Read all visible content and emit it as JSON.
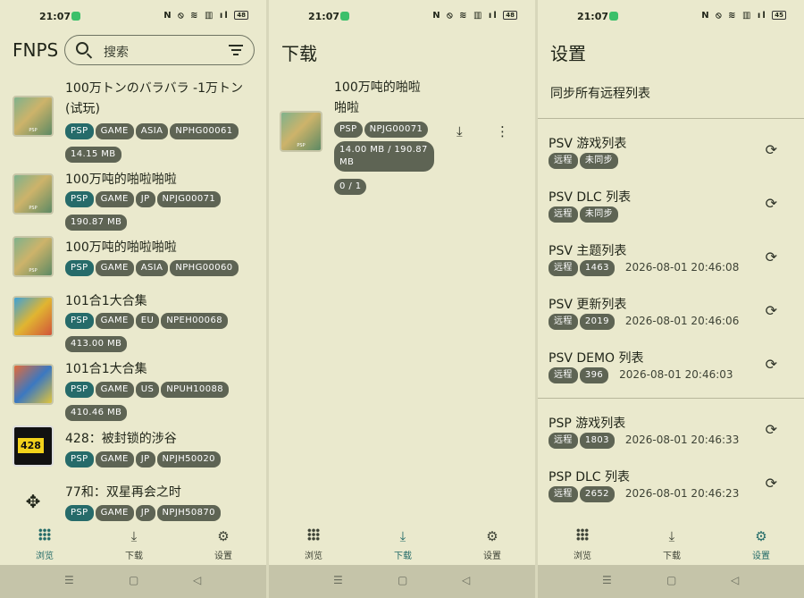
{
  "status": {
    "time": "21:07",
    "battery1": "48",
    "battery2": "48",
    "battery3": "45",
    "icons": "N ⦸ ≋ ▥ ıl"
  },
  "browse": {
    "title": "FNPS",
    "search_placeholder": "搜索",
    "games": [
      {
        "name": "100万トンのバラバラ -1万トン(试玩)",
        "tags": [
          "PSP",
          "GAME",
          "ASIA",
          "NPHG00061",
          "14.15 MB"
        ],
        "thumb": "psp"
      },
      {
        "name": "100万吨的啪啦啪啦",
        "tags": [
          "PSP",
          "GAME",
          "JP",
          "NPJG00071",
          "190.87 MB"
        ],
        "thumb": "psp"
      },
      {
        "name": "100万吨的啪啦啪啦",
        "tags": [
          "PSP",
          "GAME",
          "ASIA",
          "NPHG00060"
        ],
        "thumb": "psp"
      },
      {
        "name": "101合1大合集",
        "tags": [
          "PSP",
          "GAME",
          "EU",
          "NPEH00068",
          "413.00 MB"
        ],
        "thumb": "t101"
      },
      {
        "name": "101合1大合集",
        "tags": [
          "PSP",
          "GAME",
          "US",
          "NPUH10088",
          "410.46 MB"
        ],
        "thumb": "t101b"
      },
      {
        "name": "428：被封锁的涉谷",
        "tags": [
          "PSP",
          "GAME",
          "JP",
          "NPJH50020"
        ],
        "thumb": "t428",
        "thumb_text": "428"
      },
      {
        "name": "77和：双星再会之时",
        "tags": [
          "PSP",
          "GAME",
          "JP",
          "NPJH50870"
        ],
        "thumb": "pad"
      }
    ]
  },
  "downloads": {
    "title": "下载",
    "item": {
      "name_line1": "100万吨的啪啦",
      "name_line2": "啪啦",
      "tags": [
        "PSP",
        "NPJG00071"
      ],
      "progress_text": "14.00 MB / 190.87 MB",
      "count": "0 / 1"
    }
  },
  "settings": {
    "title": "设置",
    "sync_all": "同步所有远程列表",
    "group1": [
      {
        "title": "PSV 游戏列表",
        "tags": [
          "远程",
          "未同步"
        ],
        "date": ""
      },
      {
        "title": "PSV DLC 列表",
        "tags": [
          "远程",
          "未同步"
        ],
        "date": ""
      },
      {
        "title": "PSV 主题列表",
        "tags": [
          "远程",
          "1463"
        ],
        "date": "2026-08-01 20:46:08"
      },
      {
        "title": "PSV 更新列表",
        "tags": [
          "远程",
          "2019"
        ],
        "date": "2026-08-01 20:46:06"
      },
      {
        "title": "PSV DEMO 列表",
        "tags": [
          "远程",
          "396"
        ],
        "date": "2026-08-01 20:46:03"
      }
    ],
    "group2": [
      {
        "title": "PSP 游戏列表",
        "tags": [
          "远程",
          "1803"
        ],
        "date": "2026-08-01 20:46:33"
      },
      {
        "title": "PSP DLC 列表",
        "tags": [
          "远程",
          "2652"
        ],
        "date": "2026-08-01 20:46:23"
      }
    ]
  },
  "nav": {
    "browse": "浏览",
    "download": "下载",
    "settings": "设置"
  },
  "colors": {
    "background": "#eae9cd",
    "teal": "#266b6a",
    "chip": "#5e6454"
  }
}
